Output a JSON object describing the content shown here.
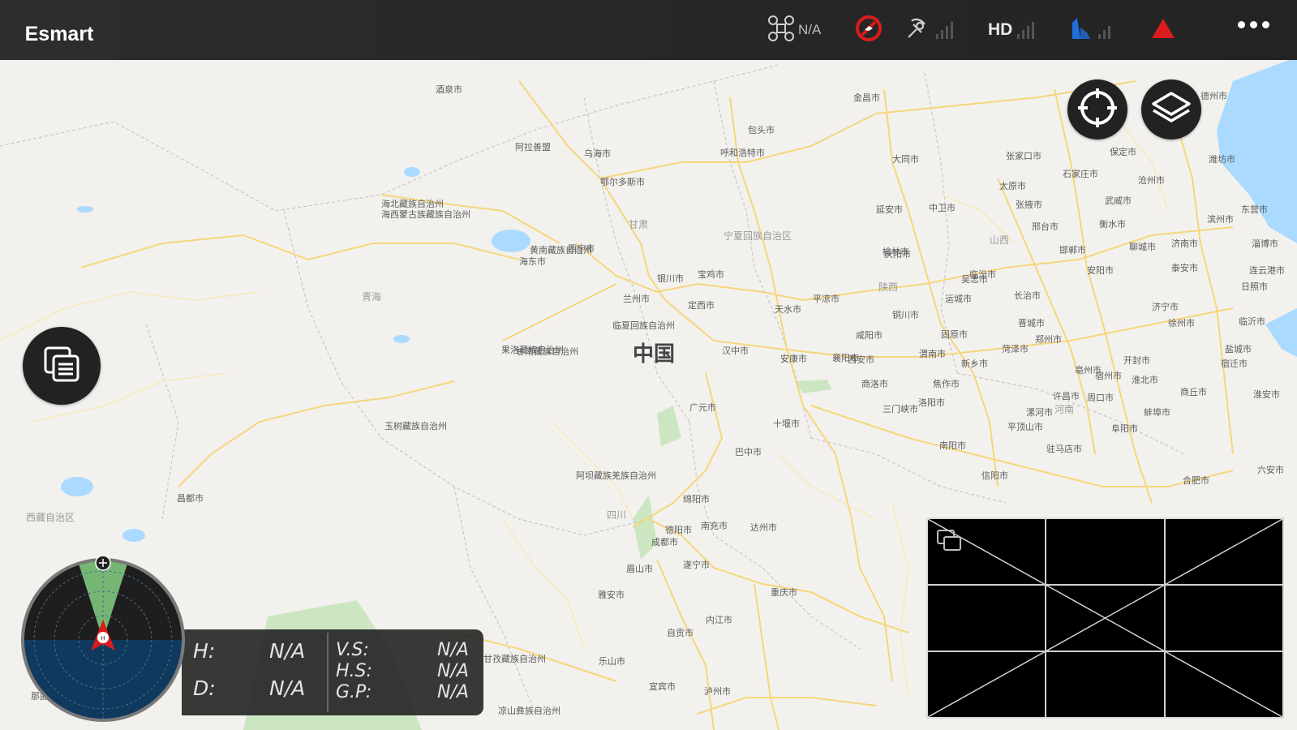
{
  "app": {
    "title": "Esmart"
  },
  "status_bar": {
    "aircraft_mode": "N/A",
    "hd_label": "HD"
  },
  "map": {
    "country_label": "中国",
    "places": [
      {
        "name": "酒泉市"
      },
      {
        "name": "阿拉善盟"
      },
      {
        "name": "乌海市"
      },
      {
        "name": "鄂尔多斯市"
      },
      {
        "name": "呼和浩特市"
      },
      {
        "name": "包头市"
      },
      {
        "name": "大同市"
      },
      {
        "name": "张家口市"
      },
      {
        "name": "保定市"
      },
      {
        "name": "石家庄市"
      },
      {
        "name": "太原市"
      },
      {
        "name": "德州市"
      },
      {
        "name": "济南市"
      },
      {
        "name": "淄博市"
      },
      {
        "name": "潍坊市"
      },
      {
        "name": "临沂市"
      },
      {
        "name": "济宁市"
      },
      {
        "name": "泰安市"
      },
      {
        "name": "菏泽市"
      },
      {
        "name": "郑州市"
      },
      {
        "name": "开封市"
      },
      {
        "name": "商丘市"
      },
      {
        "name": "许昌市"
      },
      {
        "name": "周口市"
      },
      {
        "name": "平顶山市"
      },
      {
        "name": "南阳市"
      },
      {
        "name": "信阳市"
      },
      {
        "name": "合肥市"
      },
      {
        "name": "六安市"
      },
      {
        "name": "盐城市"
      },
      {
        "name": "十堰市"
      },
      {
        "name": "襄阳市"
      },
      {
        "name": "安康市"
      },
      {
        "name": "汉中市"
      },
      {
        "name": "广元市"
      },
      {
        "name": "巴中市"
      },
      {
        "name": "达州市"
      },
      {
        "name": "南充市"
      },
      {
        "name": "绵阳市"
      },
      {
        "name": "德阳市"
      },
      {
        "name": "成都市"
      },
      {
        "name": "眉山市"
      },
      {
        "name": "乐山市"
      },
      {
        "name": "雅安市"
      },
      {
        "name": "重庆市"
      },
      {
        "name": "遂宁市"
      },
      {
        "name": "内江市"
      },
      {
        "name": "泸州市"
      },
      {
        "name": "宜宾市"
      },
      {
        "name": "自贡市"
      },
      {
        "name": "凉山彝族自治州"
      },
      {
        "name": "甘孜藏族自治州"
      },
      {
        "name": "阿坝藏族羌族自治州"
      },
      {
        "name": "西宁市"
      },
      {
        "name": "海东市"
      },
      {
        "name": "海北藏族自治州"
      },
      {
        "name": "海西蒙古族藏族自治州"
      },
      {
        "name": "兰州市"
      },
      {
        "name": "定西市"
      },
      {
        "name": "天水市"
      },
      {
        "name": "平凉市"
      },
      {
        "name": "庆阳市"
      },
      {
        "name": "临夏回族自治州"
      },
      {
        "name": "甘南藏族自治州"
      },
      {
        "name": "固原市"
      },
      {
        "name": "吴忠市"
      },
      {
        "name": "银川市"
      },
      {
        "name": "中卫市"
      },
      {
        "name": "武威市"
      },
      {
        "name": "张掖市"
      },
      {
        "name": "金昌市"
      },
      {
        "name": "宝鸡市"
      },
      {
        "name": "西安市"
      },
      {
        "name": "延安市"
      },
      {
        "name": "榆林市"
      },
      {
        "name": "渭南市"
      },
      {
        "name": "咸阳市"
      },
      {
        "name": "铜川市"
      },
      {
        "name": "商洛市"
      },
      {
        "name": "临汾市"
      },
      {
        "name": "运城市"
      },
      {
        "name": "长治市"
      },
      {
        "name": "晋城市"
      },
      {
        "name": "邢台市"
      },
      {
        "name": "邯郸市"
      },
      {
        "name": "安阳市"
      },
      {
        "name": "新乡市"
      },
      {
        "name": "焦作市"
      },
      {
        "name": "洛阳市"
      },
      {
        "name": "三门峡市"
      },
      {
        "name": "滨州市"
      },
      {
        "name": "东营市"
      },
      {
        "name": "沧州市"
      },
      {
        "name": "衡水市"
      },
      {
        "name": "聊城市"
      },
      {
        "name": "日照市"
      },
      {
        "name": "连云港市"
      },
      {
        "name": "徐州市"
      },
      {
        "name": "宿迁市"
      },
      {
        "name": "淮安市"
      },
      {
        "name": "宿州市"
      },
      {
        "name": "淮北市"
      },
      {
        "name": "蚌埠市"
      },
      {
        "name": "阜阳市"
      },
      {
        "name": "亳州市"
      },
      {
        "name": "驻马店市"
      },
      {
        "name": "漯河市"
      },
      {
        "name": "西藏自治区"
      },
      {
        "name": "青海"
      },
      {
        "name": "甘肃"
      },
      {
        "name": "四川"
      },
      {
        "name": "宁夏回族自治区"
      },
      {
        "name": "陕西"
      },
      {
        "name": "山西"
      },
      {
        "name": "河南"
      },
      {
        "name": "玉树藏族自治州"
      },
      {
        "name": "果洛藏族自治州"
      },
      {
        "name": "黄南藏族自治州"
      },
      {
        "name": "昌都市"
      },
      {
        "name": "那曲市"
      }
    ]
  },
  "telemetry": {
    "h_label": "H:",
    "h_value": "N/A",
    "d_label": "D:",
    "d_value": "N/A",
    "vs_label": "V.S:",
    "vs_value": "N/A",
    "hs_label": "H.S:",
    "hs_value": "N/A",
    "gp_label": "G.P:",
    "gp_value": "N/A"
  },
  "icons": {
    "aircraft": "drone-icon",
    "no_fly": "no-fly-zone-icon",
    "remote": "remote-controller-icon",
    "hd_signal": "hd-signal-icon",
    "battery": "battery-icon",
    "warning": "warning-icon",
    "more": "more-icon",
    "locate": "locate-icon",
    "layers": "layers-icon",
    "switch_view": "switch-view-icon"
  },
  "colors": {
    "accent_red": "#d91c1c",
    "accent_blue": "#1e6fd9",
    "radar_sky": "#0f3a5e",
    "radar_fov": "#7ec77e"
  }
}
